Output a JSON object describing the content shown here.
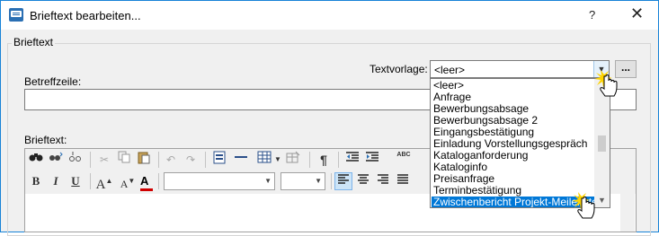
{
  "window": {
    "title": "Brieftext bearbeiten...",
    "help_label": "?",
    "close_label": "✕"
  },
  "form": {
    "group_label": "Brieftext",
    "textvorlage_label": "Textvorlage:",
    "textvorlage_value": "<leer>",
    "browse_label": "...",
    "betreff_label": "Betreffzeile:",
    "betreff_value": "",
    "brieftext_label": "Brieftext:"
  },
  "dropdown": {
    "options": [
      "<leer>",
      "Anfrage",
      "Bewerbungsabsage",
      "Bewerbungsabsage 2",
      "Eingangsbestätigung",
      "Einladung Vorstellungsgespräch",
      "Kataloganforderung",
      "Kataloginfo",
      "Preisanfrage",
      "Terminbestätigung",
      "Zwischenbericht Projekt-Meilenstein"
    ],
    "selected": "Zwischenbericht Projekt-Meilenstein"
  },
  "toolbar": {
    "font_name": "",
    "font_size": "",
    "bold_label": "B",
    "italic_label": "I",
    "underline_label": "U",
    "grow_font_label": "A",
    "shrink_font_label": "A",
    "font_color_label": "A",
    "pilcrow_label": "¶",
    "abc_label": "ABC",
    "font_color": "#d00000",
    "icons": [
      "find-icon",
      "find-replace-icon",
      "find-next-icon",
      "cut-icon",
      "copy-icon",
      "paste-icon",
      "undo-icon",
      "redo-icon",
      "insert-field-icon",
      "horizontal-line-icon",
      "table-icon",
      "table-dropdown-icon",
      "table-edit-icon",
      "show-formatting-icon",
      "decrease-indent-icon",
      "increase-indent-icon",
      "spellcheck-icon",
      "align-left-icon",
      "align-center-icon",
      "align-right-icon",
      "justify-icon"
    ]
  },
  "colors": {
    "accent": "#0078d7",
    "window_border": "#1883d7",
    "cursor_highlight": "#ffd400"
  }
}
